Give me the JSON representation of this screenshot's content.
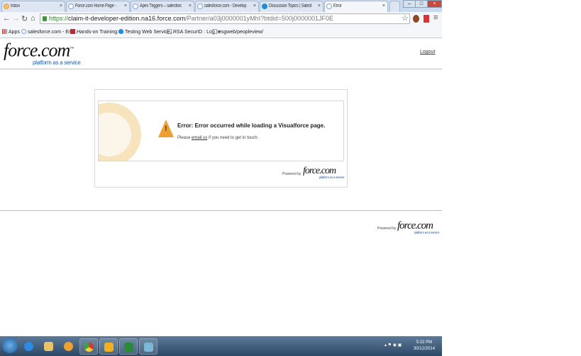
{
  "browser": {
    "tabs": [
      {
        "title": "Inbox"
      },
      {
        "title": "Force.com Home Page -"
      },
      {
        "title": "Apex Triggers – salesforc"
      },
      {
        "title": "salesforce.com - Develop"
      },
      {
        "title": "Discussion Topics | Salesf"
      },
      {
        "title": "Error",
        "active": true
      }
    ],
    "tab_close": "×",
    "url_scheme": "https://",
    "url_host": "claim-it-developer-edition.na16.force.com",
    "url_path": "/Partner/a03j0000001yMhI?btdid=500j0000001JF0E",
    "bookmarks": [
      {
        "label": "Apps"
      },
      {
        "label": "salesforce.com - Ent..."
      },
      {
        "label": "Hands-on Training: ..."
      },
      {
        "label": "Testing Web Service..."
      },
      {
        "label": "RSA SecurID : Log In"
      },
      {
        "label": "esgweb/peopleview/"
      }
    ]
  },
  "header": {
    "logo_main": "force.com",
    "logo_tm": "™",
    "logo_sub": "platform as a service",
    "logout": "Logout"
  },
  "error": {
    "title": "Error: Error occurred while loading a Visualforce page.",
    "msg_prefix": "Please ",
    "msg_link": "email us",
    "msg_suffix": " if you need to get in touch.",
    "icon": "warning-icon"
  },
  "powered": {
    "label": "Powered by",
    "logo_main": "force.com",
    "logo_sub": "platform as a service"
  },
  "taskbar": {
    "time": "5:22 PM",
    "date": "30/12/2014"
  },
  "colors": {
    "accent": "#1a5fb4",
    "warning": "#f0a030"
  }
}
